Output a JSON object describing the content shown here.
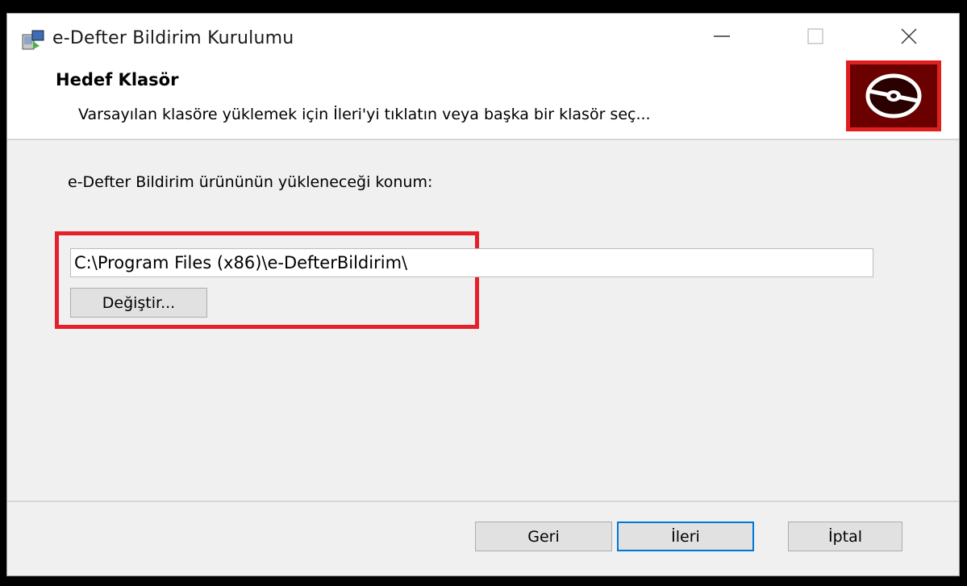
{
  "window": {
    "title": "e-Defter Bildirim Kurulumu",
    "minimize_icon": "minimize-icon",
    "maximize_icon": "maximize-icon",
    "close_icon": "close-icon"
  },
  "header": {
    "title": "Hedef Klasör",
    "description": "Varsayılan klasöre yüklemek için İleri'yi tıklatın veya başka bir klasör seç...",
    "icon": "disc-icon"
  },
  "main": {
    "location_label": "e-Defter Bildirim ürününün yükleneceği konum:",
    "path_value": "C:\\Program Files (x86)\\e-DefterBildirim\\",
    "change_button": "Değiştir..."
  },
  "footer": {
    "back_button": "Geri",
    "next_button": "İleri",
    "cancel_button": "İptal"
  },
  "colors": {
    "highlight_frame": "#e6202a",
    "default_button_border": "#0078d7",
    "banner_icon_bg": "#6b0000"
  }
}
